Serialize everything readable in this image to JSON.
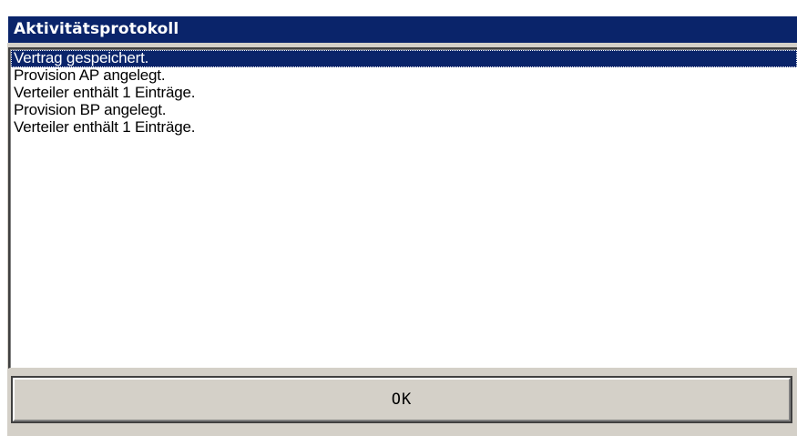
{
  "window": {
    "title": "Aktivitätsprotokoll"
  },
  "log": {
    "items": [
      {
        "text": "Vertrag gespeichert.",
        "selected": true
      },
      {
        "text": "Provision AP angelegt.",
        "selected": false
      },
      {
        "text": "Verteiler enthält 1 Einträge.",
        "selected": false
      },
      {
        "text": "Provision BP angelegt.",
        "selected": false
      },
      {
        "text": "Verteiler enthält 1 Einträge.",
        "selected": false
      }
    ]
  },
  "buttons": {
    "ok_label": "OK"
  },
  "colors": {
    "titlebar": "#0a246a",
    "selection": "#0a246a",
    "face": "#d4d0c8"
  }
}
